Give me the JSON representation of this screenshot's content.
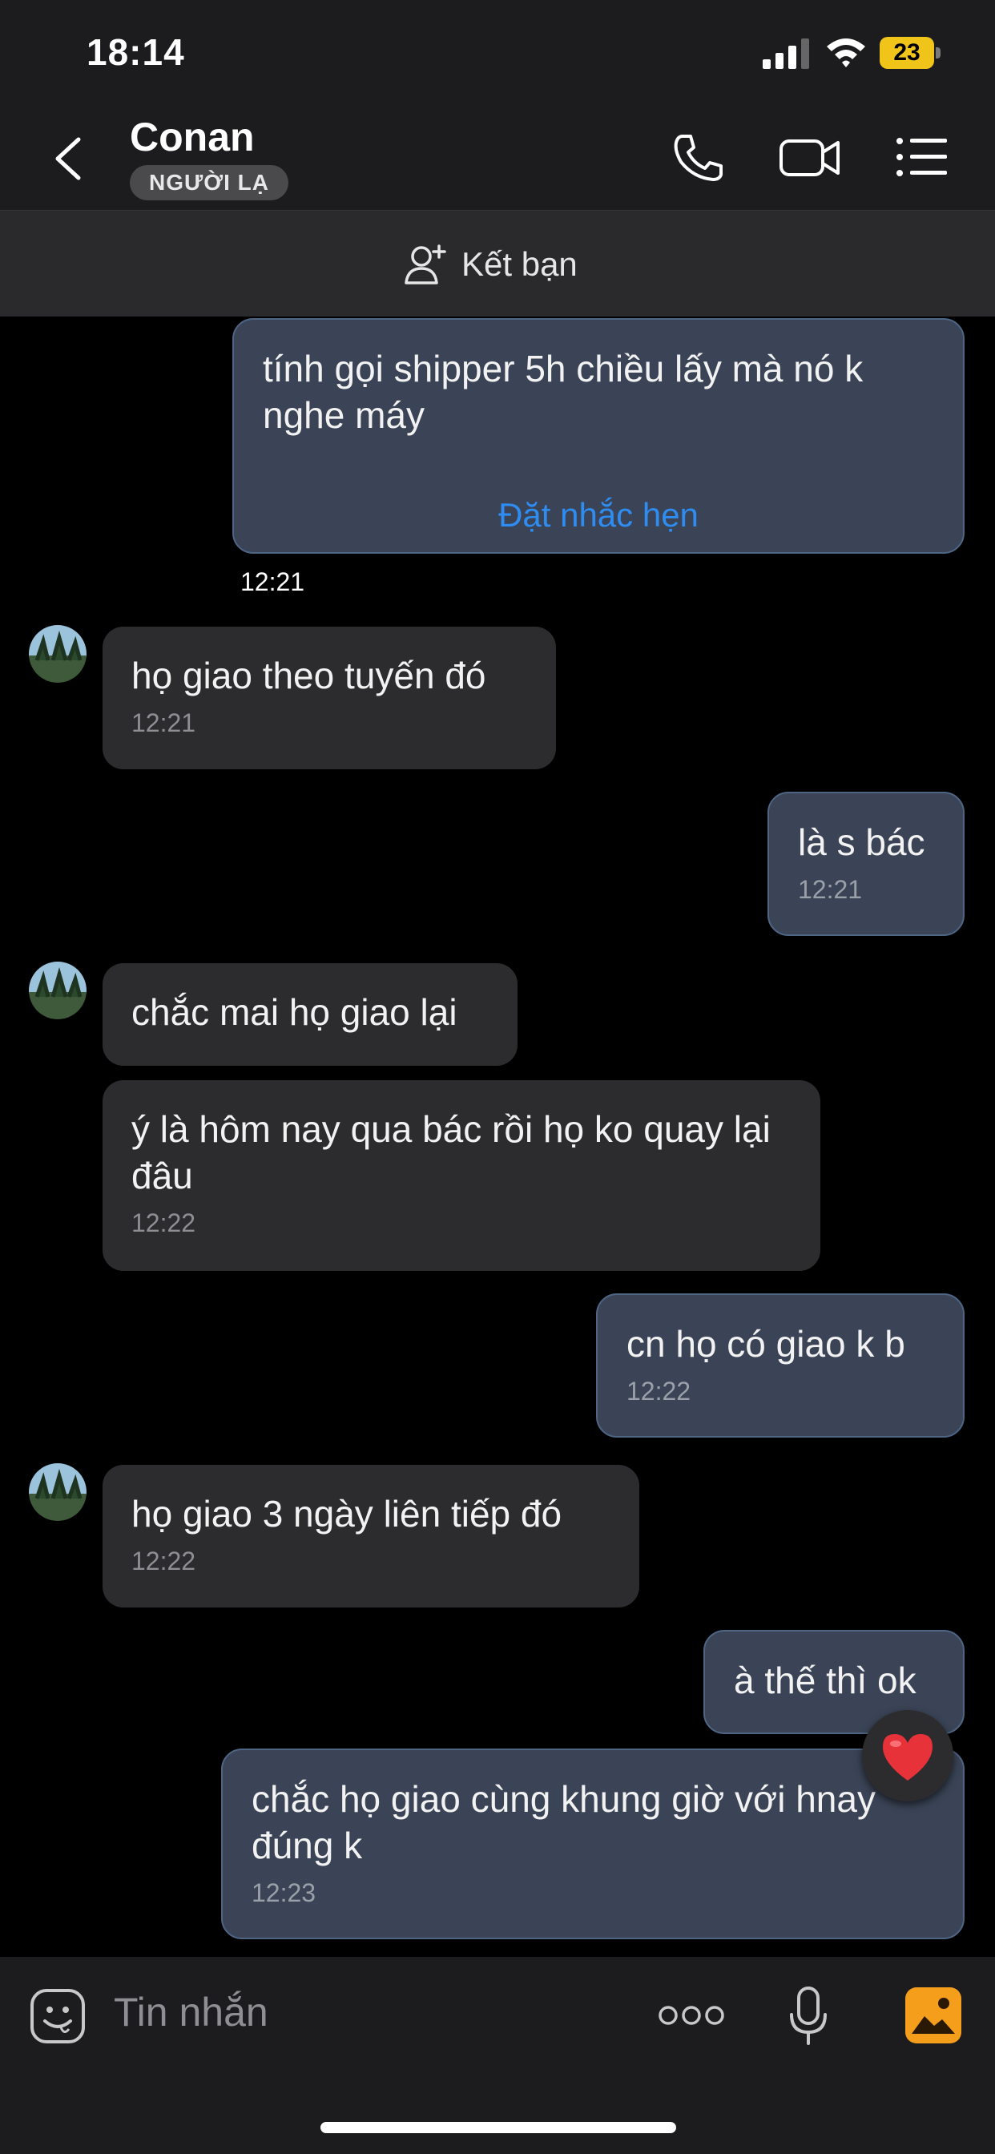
{
  "status_bar": {
    "time": "18:14",
    "battery_level": "23"
  },
  "header": {
    "contact_name": "Conan",
    "badge": "NGƯỜI LẠ"
  },
  "add_friend": {
    "label": "Kết bạn"
  },
  "messages": [
    {
      "text": "tính gọi shipper 5h chiều lấy mà nó k nghe máy",
      "time": "12:21",
      "action": "Đặt nhắc hẹn"
    },
    {
      "text": "họ giao theo tuyến đó",
      "time": "12:21"
    },
    {
      "text": "là s bác",
      "time": "12:21"
    },
    {
      "text": "chắc mai họ giao lại"
    },
    {
      "text": "ý là hôm nay qua bác rồi họ ko quay lại đâu",
      "time": "12:22"
    },
    {
      "text": "cn họ có giao k b",
      "time": "12:22"
    },
    {
      "text": "họ giao 3 ngày liên tiếp đó",
      "time": "12:22"
    },
    {
      "text": "à thế thì ok"
    },
    {
      "text": "chắc họ giao cùng khung giờ với hnay đúng k",
      "time": "12:23"
    }
  ],
  "composer": {
    "placeholder": "Tin nhắn"
  },
  "colors": {
    "outgoing_bubble": "#3a4456",
    "incoming_bubble": "#2c2c2e",
    "link": "#2f8cf0",
    "badge_bg": "#4a4a4c"
  },
  "icons": [
    "back-chevron-icon",
    "phone-icon",
    "video-call-icon",
    "menu-list-icon",
    "add-friend-icon",
    "emoji-icon",
    "more-dots-icon",
    "mic-icon",
    "photo-icon",
    "heart-reaction-icon"
  ]
}
